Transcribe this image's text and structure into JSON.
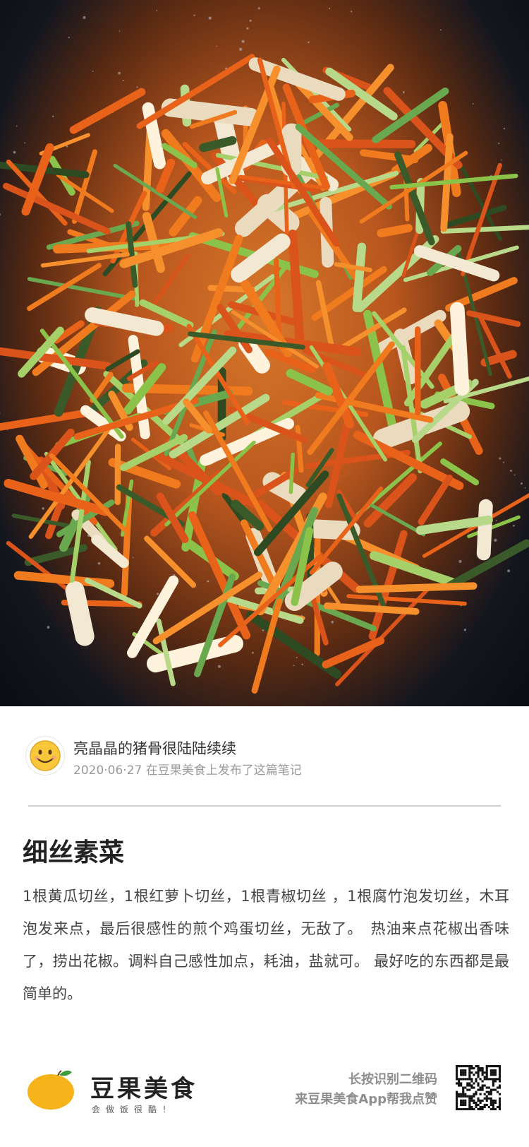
{
  "photo": {
    "subject": "stir-fried shredded vegetables in a wok"
  },
  "author": {
    "avatar_icon": "smiley-face-icon",
    "name": "亮晶晶的猪骨很陆陆续续",
    "meta": "2020·06·27 在豆果美食上发布了这篇笔记"
  },
  "note": {
    "title": "细丝素菜",
    "body": "1根黄瓜切丝，1根红萝卜切丝，1根青椒切丝 ，1根腐竹泡发切丝，木耳泡发来点，最后很感性的煎个鸡蛋切丝，无敌了。　热油来点花椒出香味了，捞出花椒。调料自己感性加点，耗油，盐就可。 最好吃的东西都是最简单的。"
  },
  "footer": {
    "brand_name": "豆果美食",
    "brand_slogan": "会做饭很酷！",
    "cta_line1": "长按识别二维码",
    "cta_line2": "来豆果美食App帮我点赞",
    "logo_icon": "douguo-mango-logo-icon",
    "qr_icon": "qr-code-icon",
    "brand_color": "#f6b41a"
  }
}
